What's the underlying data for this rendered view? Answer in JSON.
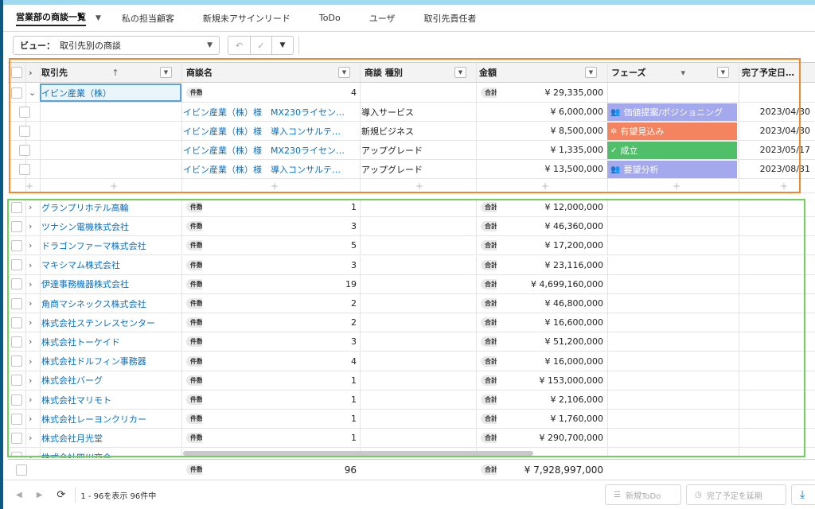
{
  "tabs": [
    {
      "label": "営業部の商談一覧",
      "active": true
    },
    {
      "label": "私の担当顧客"
    },
    {
      "label": "新規未アサインリード"
    },
    {
      "label": "ToDo"
    },
    {
      "label": "ユーザ"
    },
    {
      "label": "取引先責任者"
    }
  ],
  "toolbar": {
    "view_prefix": "ビュー：",
    "view_value": "取引先別の商談"
  },
  "columns": {
    "account": "取引先",
    "deal_name": "商談名",
    "deal_type": "商談 種別",
    "amount": "金額",
    "phase": "フェーズ",
    "close_date": "完了予定日…"
  },
  "labels": {
    "count": "件数",
    "total": "合計",
    "add": "+"
  },
  "expanded_group": {
    "account": "イビン産業（株）",
    "count": "4",
    "total": "¥ 29,335,000",
    "deals": [
      {
        "name": "イビン産業（株）様　MX230ライセン…",
        "type": "導入サービス",
        "amount": "¥ 6,000,000",
        "phase": "価値提案/ポジショニング",
        "phase_color": "#a3a9ec",
        "phase_icon": "users-icon",
        "date": "2023/04/30"
      },
      {
        "name": "イビン産業（株）様　導入コンサルテ…",
        "type": "新規ビジネス",
        "amount": "¥ 8,500,000",
        "phase": "有望見込み",
        "phase_color": "#f4845f",
        "phase_icon": "sparkle-icon",
        "date": "2023/04/30"
      },
      {
        "name": "イビン産業（株）様　MX230ライセン…",
        "type": "アップグレード",
        "amount": "¥ 1,335,000",
        "phase": "成立",
        "phase_color": "#4fbf6a",
        "phase_icon": "check-icon",
        "date": "2023/05/17"
      },
      {
        "name": "イビン産業（株）様　導入コンサルテ…",
        "type": "アップグレード",
        "amount": "¥ 13,500,000",
        "phase": "要望分析",
        "phase_color": "#a3a9ec",
        "phase_icon": "users-icon",
        "date": "2023/08/31"
      }
    ]
  },
  "groups": [
    {
      "account": "グランプリホテル高輪",
      "count": "1",
      "total": "¥ 12,000,000"
    },
    {
      "account": "ツナシン電機株式会社",
      "count": "3",
      "total": "¥ 46,360,000"
    },
    {
      "account": "ドラゴンファーマ株式会社",
      "count": "5",
      "total": "¥ 17,200,000"
    },
    {
      "account": "マキシマム株式会社",
      "count": "3",
      "total": "¥ 23,116,000"
    },
    {
      "account": "伊達事務機器株式会社",
      "count": "19",
      "total": "¥ 4,699,160,000"
    },
    {
      "account": "角商マシネックス株式会社",
      "count": "2",
      "total": "¥ 46,800,000"
    },
    {
      "account": "株式会社ステンレスセンター",
      "count": "2",
      "total": "¥ 16,600,000"
    },
    {
      "account": "株式会社トーケイド",
      "count": "3",
      "total": "¥ 51,200,000"
    },
    {
      "account": "株式会社ドルフィン事務器",
      "count": "4",
      "total": "¥ 16,000,000"
    },
    {
      "account": "株式会社バーグ",
      "count": "1",
      "total": "¥ 153,000,000"
    },
    {
      "account": "株式会社マリモト",
      "count": "1",
      "total": "¥ 2,106,000"
    },
    {
      "account": "株式会社レーヨンクリカー",
      "count": "1",
      "total": "¥ 1,760,000"
    },
    {
      "account": "株式会社月光堂",
      "count": "1",
      "total": "¥ 290,700,000"
    },
    {
      "account": "株式会社四川商会",
      "count": "",
      "total": ""
    }
  ],
  "grand_total": {
    "count": "96",
    "total": "¥ 7,928,997,000"
  },
  "footer": {
    "record_info": "1 - 96を表示 96件中",
    "new_todo": "新規ToDo",
    "extend_close": "完了予定を延期"
  },
  "colors": {
    "accent_link": "#0b6fbd",
    "orange_box": "#ef8a2b",
    "green_box": "#6fd05b"
  }
}
